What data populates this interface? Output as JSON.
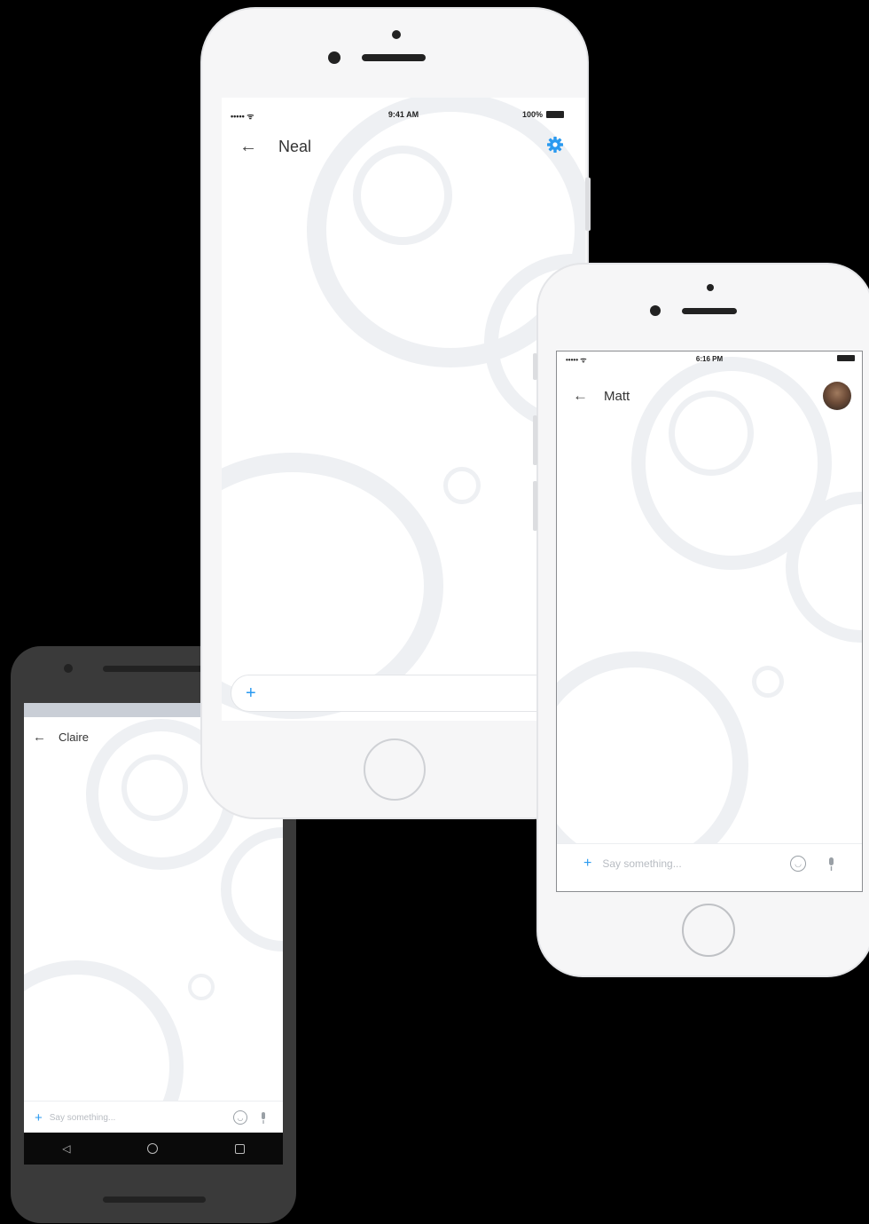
{
  "phones": {
    "iphone_center": {
      "status": {
        "signal": "••••• ᯤ",
        "time": "9:41 AM",
        "battery": "100%"
      },
      "header": {
        "back_icon": "arrow-left-icon",
        "title": "Neal",
        "settings_icon": "gear-icon"
      },
      "composer": {
        "add_icon": "plus-icon",
        "placeholder": ""
      },
      "accent": "#2a9af0"
    },
    "iphone_right": {
      "status": {
        "signal": "••••• ᯤ",
        "time": "6:16 PM",
        "battery": ""
      },
      "header": {
        "back_icon": "arrow-left-icon",
        "title": "Matt",
        "avatar_icon": "avatar"
      },
      "composer": {
        "add_icon": "plus-icon",
        "placeholder": "Say something...",
        "emoji_icon": "emoji-icon",
        "mic_icon": "mic-icon"
      }
    },
    "android_left": {
      "header": {
        "back_icon": "arrow-left-icon",
        "title": "Claire"
      },
      "composer": {
        "add_icon": "plus-icon",
        "placeholder": "Say something...",
        "emoji_icon": "emoji-icon",
        "mic_icon": "mic-icon"
      },
      "navbar": {
        "back_icon": "triangle-back-icon",
        "home_icon": "circle-home-icon",
        "recents_icon": "square-recents-icon"
      }
    }
  }
}
